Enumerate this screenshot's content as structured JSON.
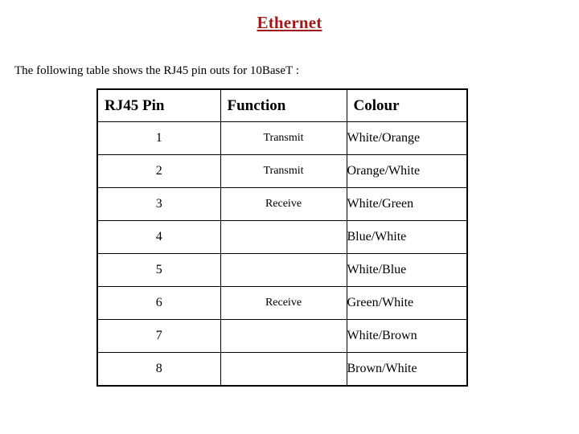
{
  "slide": {
    "title": "Ethernet",
    "intro": "The following table shows the RJ45 pin outs for 10BaseT :",
    "title_color": "#9e1a1a",
    "text_color": "#000000",
    "background_color": "#ffffff"
  },
  "table": {
    "headers": {
      "pin": "RJ45 Pin",
      "function": "Function",
      "colour": "Colour"
    },
    "rows": [
      {
        "pin": "1",
        "function": "Transmit",
        "colour": "White/Orange"
      },
      {
        "pin": "2",
        "function": "Transmit",
        "colour": "Orange/White"
      },
      {
        "pin": "3",
        "function": "Receive",
        "colour": "White/Green"
      },
      {
        "pin": "4",
        "function": "",
        "colour": "Blue/White"
      },
      {
        "pin": "5",
        "function": "",
        "colour": "White/Blue"
      },
      {
        "pin": "6",
        "function": "Receive",
        "colour": "Green/White"
      },
      {
        "pin": "7",
        "function": "",
        "colour": "White/Brown"
      },
      {
        "pin": "8",
        "function": "",
        "colour": "Brown/White"
      }
    ]
  }
}
